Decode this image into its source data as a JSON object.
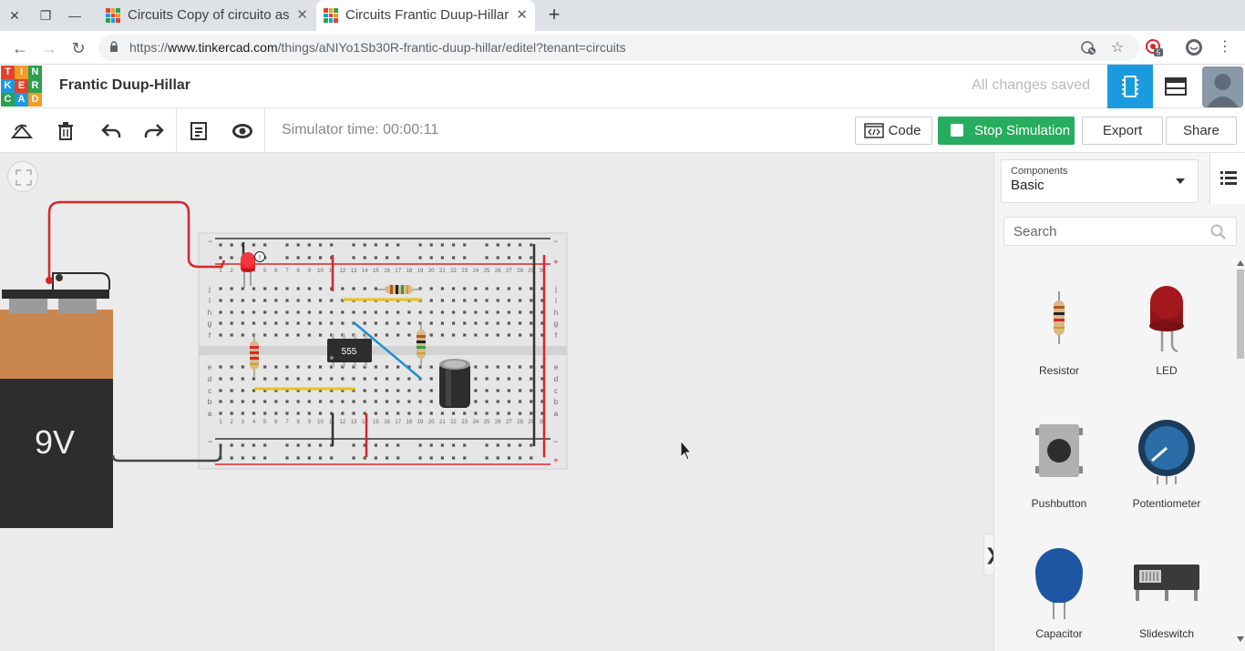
{
  "browser": {
    "tabs": [
      {
        "title": "Circuits Copy of circuito as",
        "active": false
      },
      {
        "title": "Circuits Frantic Duup-Hillar",
        "active": true
      }
    ],
    "url_prefix": "https://",
    "url_domain": "www.tinkercad.com",
    "url_path": "/things/aNIYo1Sb30R-frantic-duup-hillar/editel?tenant=circuits",
    "extension_badge": "5"
  },
  "app": {
    "logo_letters": [
      "T",
      "I",
      "N",
      "K",
      "E",
      "R",
      "C",
      "A",
      "D"
    ],
    "project_name": "Frantic Duup-Hillar",
    "save_status": "All changes saved"
  },
  "toolbar": {
    "simulator_time": "Simulator time: 00:00:11",
    "code_label": "Code",
    "stop_label": "Stop Simulation",
    "export_label": "Export",
    "share_label": "Share"
  },
  "canvas": {
    "battery_label": "9V",
    "chip_label": "555",
    "row_numbers": [
      "1",
      "2",
      "3",
      "4",
      "5",
      "6",
      "7",
      "8",
      "9",
      "10",
      "11",
      "12",
      "13",
      "14",
      "15",
      "16",
      "17",
      "18",
      "19",
      "20",
      "21",
      "22",
      "23",
      "24",
      "25",
      "26",
      "27",
      "28",
      "29",
      "30"
    ],
    "upper_row_letters": [
      "j",
      "i",
      "h",
      "g",
      "f"
    ],
    "lower_row_letters": [
      "e",
      "d",
      "c",
      "b",
      "a"
    ],
    "rail_minus": "−",
    "rail_plus": "+"
  },
  "panel": {
    "selector_label": "Components",
    "selector_value": "Basic",
    "search_placeholder": "Search",
    "components": [
      {
        "name": "Resistor"
      },
      {
        "name": "LED"
      },
      {
        "name": "Pushbutton"
      },
      {
        "name": "Potentiometer"
      },
      {
        "name": "Capacitor"
      },
      {
        "name": "Slideswitch"
      }
    ]
  },
  "colors": {
    "accent_blue": "#1a9be0",
    "stop_green": "#27ad5f",
    "wire_red": "#d9252a",
    "wire_black": "#333333",
    "wire_yellow": "#e8c31a",
    "wire_blue": "#1e8fd0"
  }
}
